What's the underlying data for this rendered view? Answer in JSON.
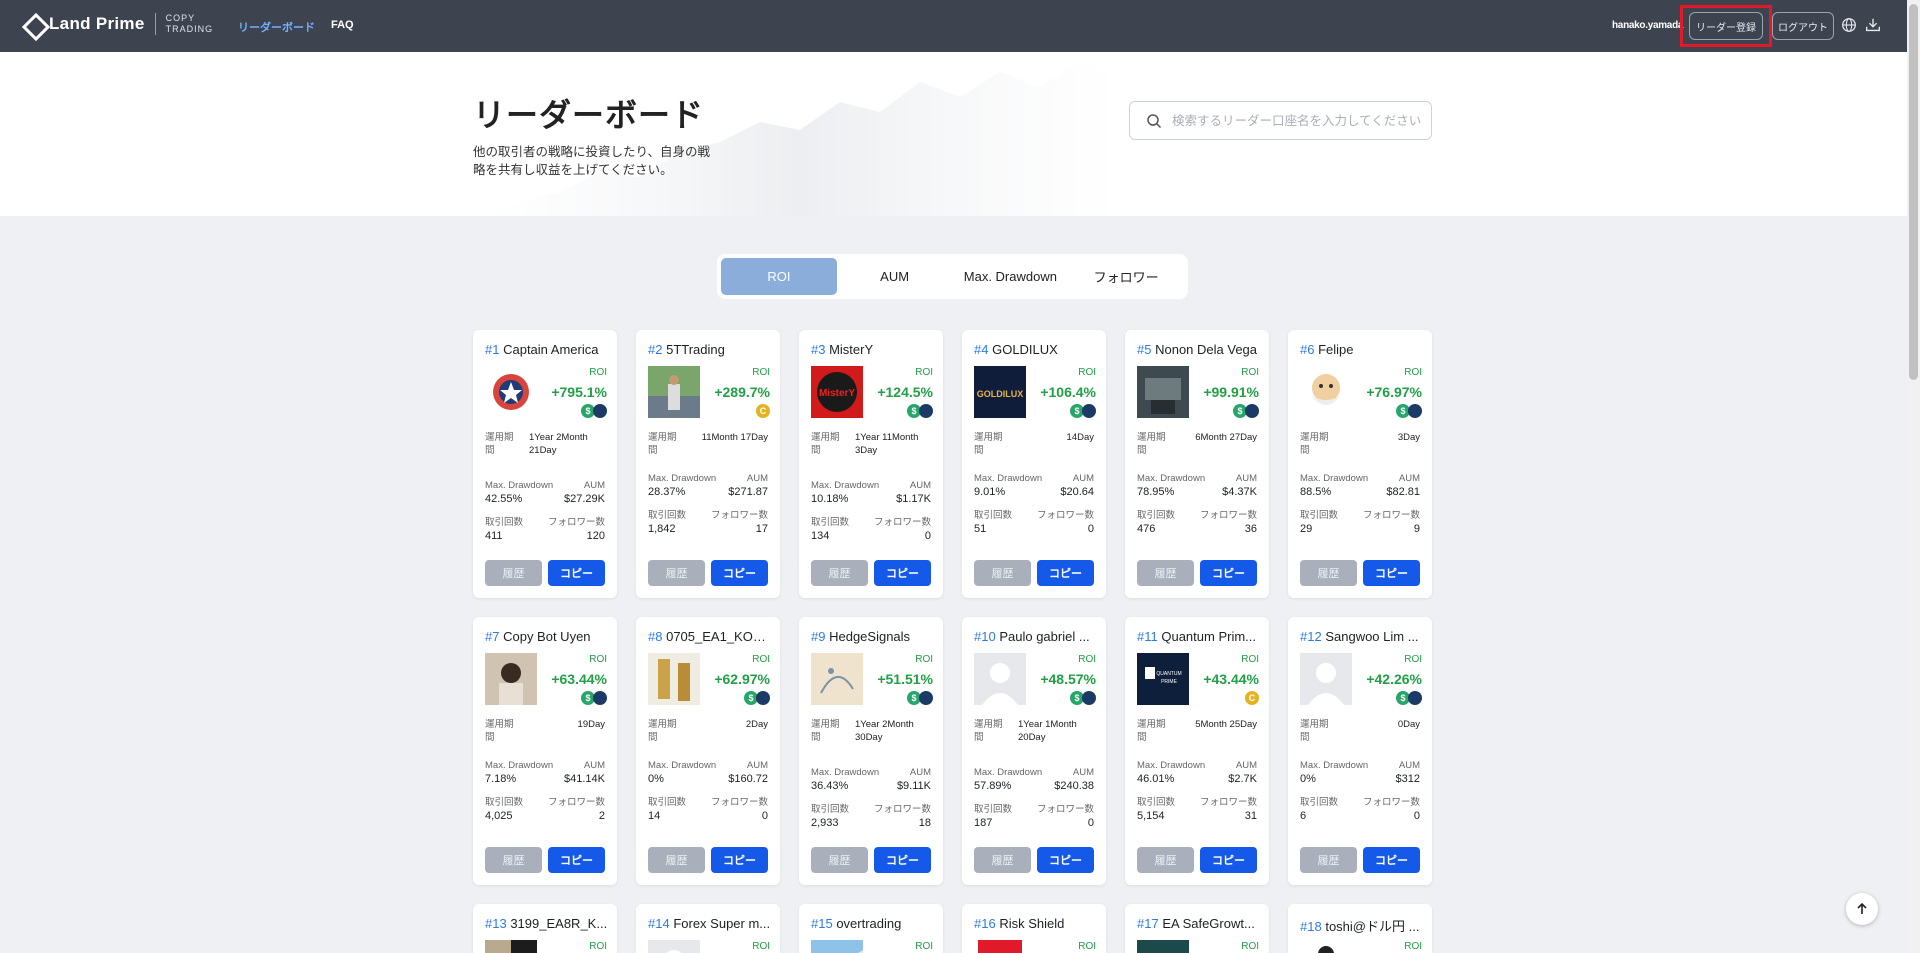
{
  "header": {
    "logo_name": "Land Prime",
    "logo_sub_1": "COPY",
    "logo_sub_2": "TRADING",
    "nav": [
      {
        "label": "リーダーボード",
        "active": true
      },
      {
        "label": "FAQ",
        "active": false
      }
    ],
    "username": "hanako.yamada",
    "register_label": "リーダー登録",
    "logout_label": "ログアウト",
    "icons": [
      "globe-icon",
      "download-icon"
    ]
  },
  "hero": {
    "title": "リーダーボード",
    "description": "他の取引者の戦略に投資したり、自身の戦略を共有し収益を上げてください。",
    "search_placeholder": "検索するリーダー口座名を入力してください"
  },
  "tabs": [
    {
      "label": "ROI",
      "active": true
    },
    {
      "label": "AUM",
      "active": false
    },
    {
      "label": "Max. Drawdown",
      "active": false
    },
    {
      "label": "フォロワー",
      "active": false
    }
  ],
  "card_labels": {
    "roi": "ROI",
    "period": "運用期間",
    "max_drawdown": "Max. Drawdown",
    "aum": "AUM",
    "trades": "取引回数",
    "followers": "フォロワー数",
    "history_btn": "履歴",
    "copy_btn": "コピー"
  },
  "leaders": [
    {
      "rank": "#1",
      "name": "Captain America",
      "roi": "+795.1%",
      "period": "1Year 2Month 21Day",
      "max_drawdown": "42.55%",
      "aum": "$27.29K",
      "trades": "411",
      "followers": "120",
      "badge": "usd"
    },
    {
      "rank": "#2",
      "name": "5TTrading",
      "roi": "+289.7%",
      "period": "11Month 17Day",
      "max_drawdown": "28.37%",
      "aum": "$271.87",
      "trades": "1,842",
      "followers": "17",
      "badge": "c"
    },
    {
      "rank": "#3",
      "name": "MisterY",
      "roi": "+124.5%",
      "period": "1Year 11Month 3Day",
      "max_drawdown": "10.18%",
      "aum": "$1.17K",
      "trades": "134",
      "followers": "0",
      "badge": "usd"
    },
    {
      "rank": "#4",
      "name": "GOLDILUX",
      "roi": "+106.4%",
      "period": "14Day",
      "max_drawdown": "9.01%",
      "aum": "$20.64",
      "trades": "51",
      "followers": "0",
      "badge": "usd"
    },
    {
      "rank": "#5",
      "name": "Nonon Dela Vega",
      "roi": "+99.91%",
      "period": "6Month 27Day",
      "max_drawdown": "78.95%",
      "aum": "$4.37K",
      "trades": "476",
      "followers": "36",
      "badge": "usd"
    },
    {
      "rank": "#6",
      "name": "Felipe",
      "roi": "+76.97%",
      "period": "3Day",
      "max_drawdown": "88.5%",
      "aum": "$82.81",
      "trades": "29",
      "followers": "9",
      "badge": "usd"
    },
    {
      "rank": "#7",
      "name": "Copy Bot Uyen",
      "roi": "+63.44%",
      "period": "19Day",
      "max_drawdown": "7.18%",
      "aum": "$41.14K",
      "trades": "4,025",
      "followers": "2",
      "badge": "usd"
    },
    {
      "rank": "#8",
      "name": "0705_EA1_KOR...",
      "roi": "+62.97%",
      "period": "2Day",
      "max_drawdown": "0%",
      "aum": "$160.72",
      "trades": "14",
      "followers": "0",
      "badge": "usd"
    },
    {
      "rank": "#9",
      "name": "HedgeSignals",
      "roi": "+51.51%",
      "period": "1Year 2Month 30Day",
      "max_drawdown": "36.43%",
      "aum": "$9.11K",
      "trades": "2,933",
      "followers": "18",
      "badge": "usd"
    },
    {
      "rank": "#10",
      "name": "Paulo gabriel ...",
      "roi": "+48.57%",
      "period": "1Year 1Month 20Day",
      "max_drawdown": "57.89%",
      "aum": "$240.38",
      "trades": "187",
      "followers": "0",
      "badge": "usd"
    },
    {
      "rank": "#11",
      "name": "Quantum Prim...",
      "roi": "+43.44%",
      "period": "5Month 25Day",
      "max_drawdown": "46.01%",
      "aum": "$2.7K",
      "trades": "5,154",
      "followers": "31",
      "badge": "c"
    },
    {
      "rank": "#12",
      "name": "Sangwoo Lim ...",
      "roi": "+42.26%",
      "period": "0Day",
      "max_drawdown": "0%",
      "aum": "$312",
      "trades": "6",
      "followers": "0",
      "badge": "usd"
    },
    {
      "rank": "#13",
      "name": "3199_EA8R_K..."
    },
    {
      "rank": "#14",
      "name": "Forex Super m..."
    },
    {
      "rank": "#15",
      "name": "overtrading"
    },
    {
      "rank": "#16",
      "name": "Risk Shield"
    },
    {
      "rank": "#17",
      "name": "EA SafeGrowt..."
    },
    {
      "rank": "#18",
      "name": "toshi@ドル円 ..."
    }
  ],
  "colors": {
    "header_bg": "#3d4450",
    "accent_blue": "#1559e8",
    "roi_green": "#21a045",
    "tab_active": "#8aaed9",
    "highlight_red": "#e11a2a"
  }
}
